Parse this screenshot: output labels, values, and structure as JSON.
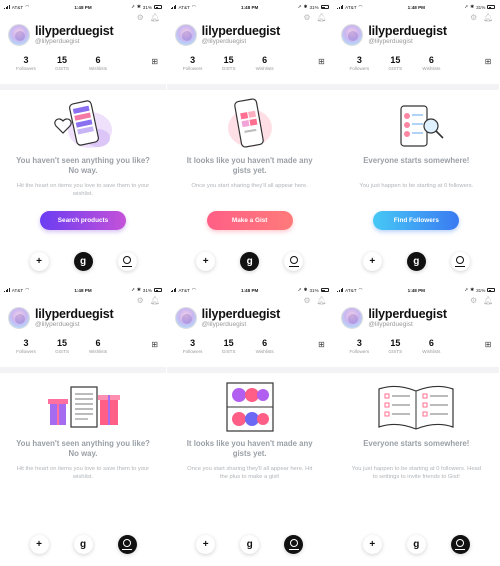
{
  "status": {
    "carrier": "AT&T",
    "time": "1:48 PM",
    "battery": "31%"
  },
  "profile": {
    "username": "lilyperduegist",
    "handle": "@lilyperduegist"
  },
  "stats": [
    {
      "value": "3",
      "label": "Followers"
    },
    {
      "value": "15",
      "label": "GISTS"
    },
    {
      "value": "6",
      "label": "Wishlists"
    }
  ],
  "panels": [
    {
      "headline": "You haven't seen anything you like? No way.",
      "sub": "Hit the heart on items you love to save them to your wishlist.",
      "cta": "Search products",
      "cta_style": "purple",
      "illustration": "phone-heart-illustration",
      "active_tab": "gist"
    },
    {
      "headline": "It looks like you haven't made any gists yet.",
      "sub": "Once you start sharing they'll all appear here.",
      "cta": "Make a Gist",
      "cta_style": "pink",
      "illustration": "phone-gist-illustration",
      "active_tab": "gist"
    },
    {
      "headline": "Everyone starts somewhere!",
      "sub": "You just happen to be starting at 0 followers.",
      "cta": "Find Followers",
      "cta_style": "blue",
      "illustration": "phone-search-illustration",
      "active_tab": "gist"
    },
    {
      "headline": "You haven't seen anything you like? No way.",
      "sub": "Hit the heart on items you love to save them to your wishlist.",
      "cta": "",
      "cta_style": "",
      "illustration": "gift-list-illustration",
      "active_tab": "profile"
    },
    {
      "headline": "It looks like you haven't made any gists yet.",
      "sub": "Once you start sharing they'll all appear here. Hit the plus to make a gist!",
      "cta": "",
      "cta_style": "",
      "illustration": "shelf-balls-illustration",
      "active_tab": "profile"
    },
    {
      "headline": "Everyone starts somewhere!",
      "sub": "You just happen to be starting at 0 followers. Head to settings to invite friends to Gist!",
      "cta": "",
      "cta_style": "",
      "illustration": "open-book-illustration",
      "active_tab": "profile"
    }
  ],
  "nav": {
    "add_icon": "plus-icon",
    "gist_icon": "gist-logo-icon",
    "profile_icon": "profile-icon"
  },
  "colors": {
    "purple_start": "#6b3cf2",
    "purple_end": "#c452d8",
    "pink_start": "#ff5f86",
    "pink_end": "#ff7a7a",
    "blue_start": "#46c8f5",
    "blue_end": "#3a7af2"
  }
}
